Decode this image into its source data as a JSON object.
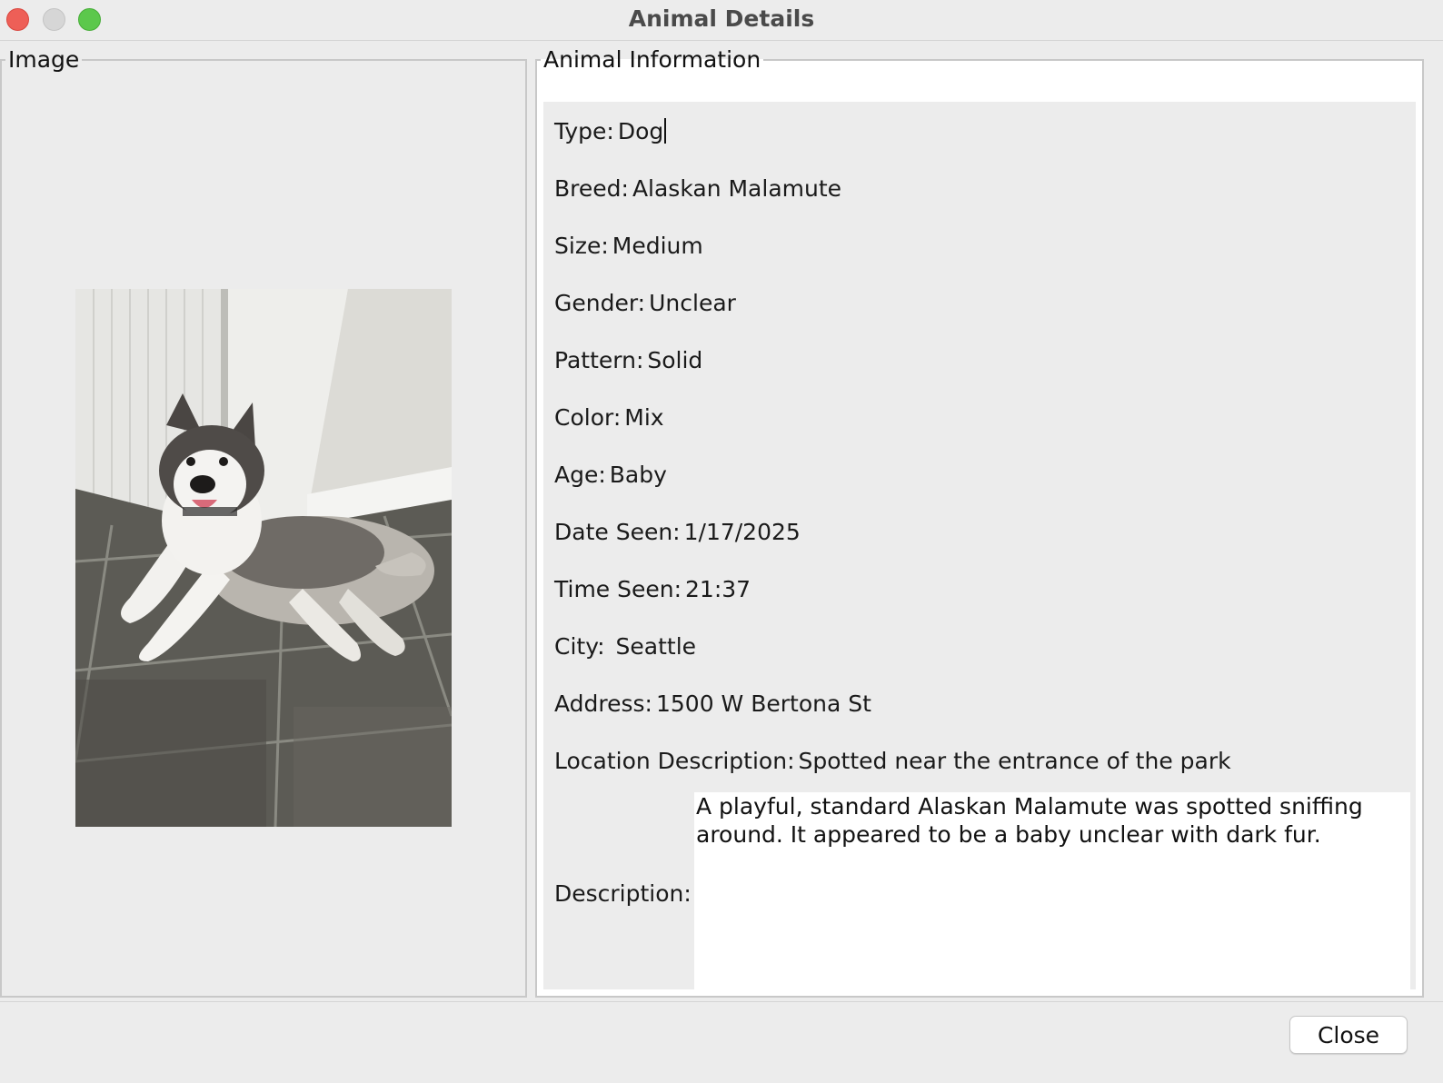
{
  "window": {
    "title": "Animal Details"
  },
  "image_panel": {
    "title": "Image",
    "photo_icon": "husky-photo"
  },
  "info_panel": {
    "title": "Animal Information",
    "fields": [
      {
        "label": "Type:",
        "value": "Dog"
      },
      {
        "label": "Breed:",
        "value": "Alaskan Malamute"
      },
      {
        "label": "Size:",
        "value": "Medium"
      },
      {
        "label": "Gender:",
        "value": "Unclear"
      },
      {
        "label": "Pattern:",
        "value": "Solid"
      },
      {
        "label": "Color:",
        "value": "Mix"
      },
      {
        "label": "Age:",
        "value": "Baby"
      },
      {
        "label": "Date Seen:",
        "value": "1/17/2025"
      },
      {
        "label": "Time Seen:",
        "value": "21:37"
      },
      {
        "label": "City:",
        "value": " Seattle"
      },
      {
        "label": "Address:",
        "value": "1500 W Bertona St"
      },
      {
        "label": "Location Description:",
        "value": "Spotted near the entrance of the park"
      }
    ],
    "description": {
      "label": "Description:",
      "value": "A playful, standard Alaskan Malamute was spotted sniffing\naround. It appeared to be a baby unclear with dark fur."
    }
  },
  "footer": {
    "close_label": "Close"
  },
  "colors": {
    "background": "#ececec",
    "close_button": "#ee5f57",
    "minimize_button": "#d6d6d6",
    "maximize_button": "#5cc84c"
  }
}
